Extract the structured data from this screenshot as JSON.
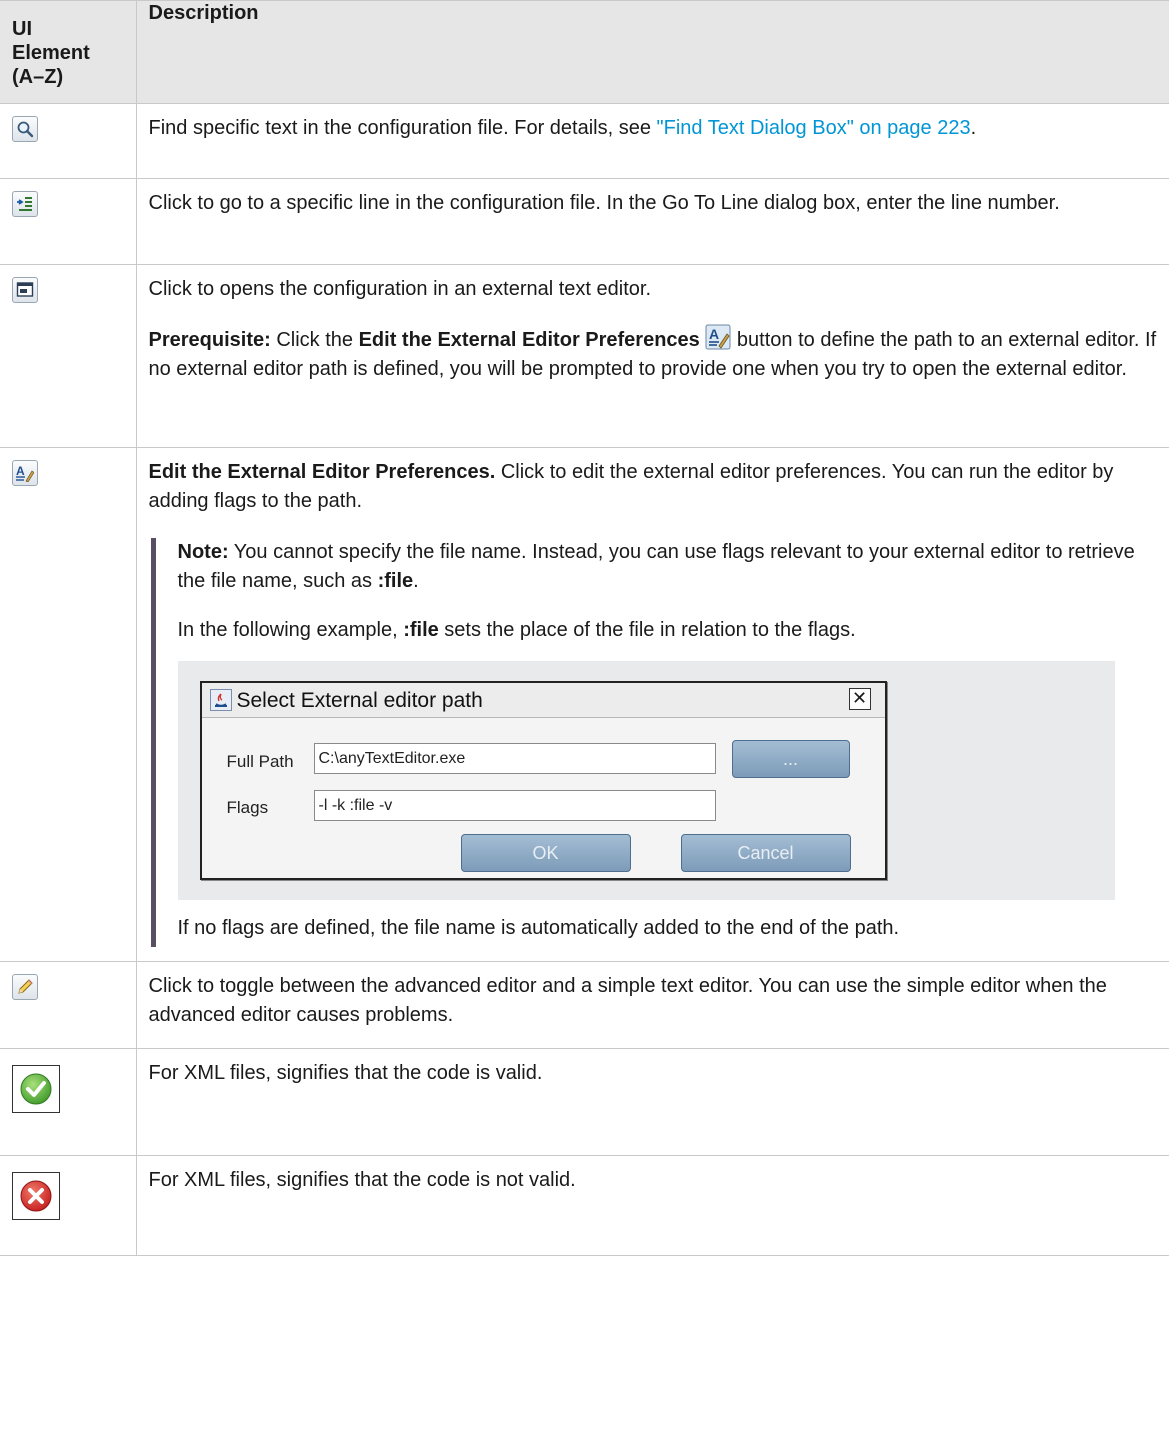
{
  "table": {
    "header": {
      "col1": [
        "UI",
        "Element",
        "(A–Z)"
      ],
      "col2": "Description"
    },
    "rows": [
      {
        "icon": "find-text-icon",
        "text_before": "Find specific text in the configuration file. For details, see ",
        "link": "\"Find Text Dialog Box\" on page 223",
        "text_after": "."
      },
      {
        "icon": "go-to-line-icon",
        "text": "Click to go to a specific line in the configuration file. In the Go To Line dialog box, enter the line number."
      },
      {
        "icon": "external-editor-icon",
        "text": "Click to opens the configuration in an external text editor.",
        "prereq_label": "Prerequisite:",
        "prereq_mid": " Click the ",
        "prereq_bold": "Edit the External Editor Preferences",
        "prereq_rest": " button to define the path to an external editor. If no external editor path is defined, you will be prompted to provide one when you try to open the external editor."
      },
      {
        "icon": "edit-preferences-icon",
        "bold": "Edit the External Editor Preferences.",
        "text": " Click to edit the external editor preferences. You can run the editor by adding flags to the path.",
        "note_label": "Note:",
        "note_text": "  You cannot specify the file name. Instead, you can use flags relevant to your external editor to retrieve the file name, such as ",
        "note_code": ":file",
        "note_end": ".",
        "example_before": "In the following example, ",
        "example_code": ":file",
        "example_after": " sets the place of the file in relation to the flags.",
        "dialog": {
          "title": "Select External editor path",
          "full_path_label": "Full Path",
          "full_path_value": "C:\\anyTextEditor.exe",
          "browse_label": "...",
          "flags_label": "Flags",
          "flags_value": "-l -k :file -v",
          "ok_label": "OK",
          "cancel_label": "Cancel"
        },
        "after_text": "If no flags are defined, the file name is automatically added to the end of the path."
      },
      {
        "icon": "pencil-icon",
        "text": "Click to toggle between the advanced editor and a simple text editor. You can use the simple editor when the advanced editor causes problems."
      },
      {
        "icon": "valid-check-icon",
        "text": "For XML files, signifies that the code is valid."
      },
      {
        "icon": "invalid-x-icon",
        "text": "For XML files, signifies that the code is not valid."
      }
    ]
  }
}
